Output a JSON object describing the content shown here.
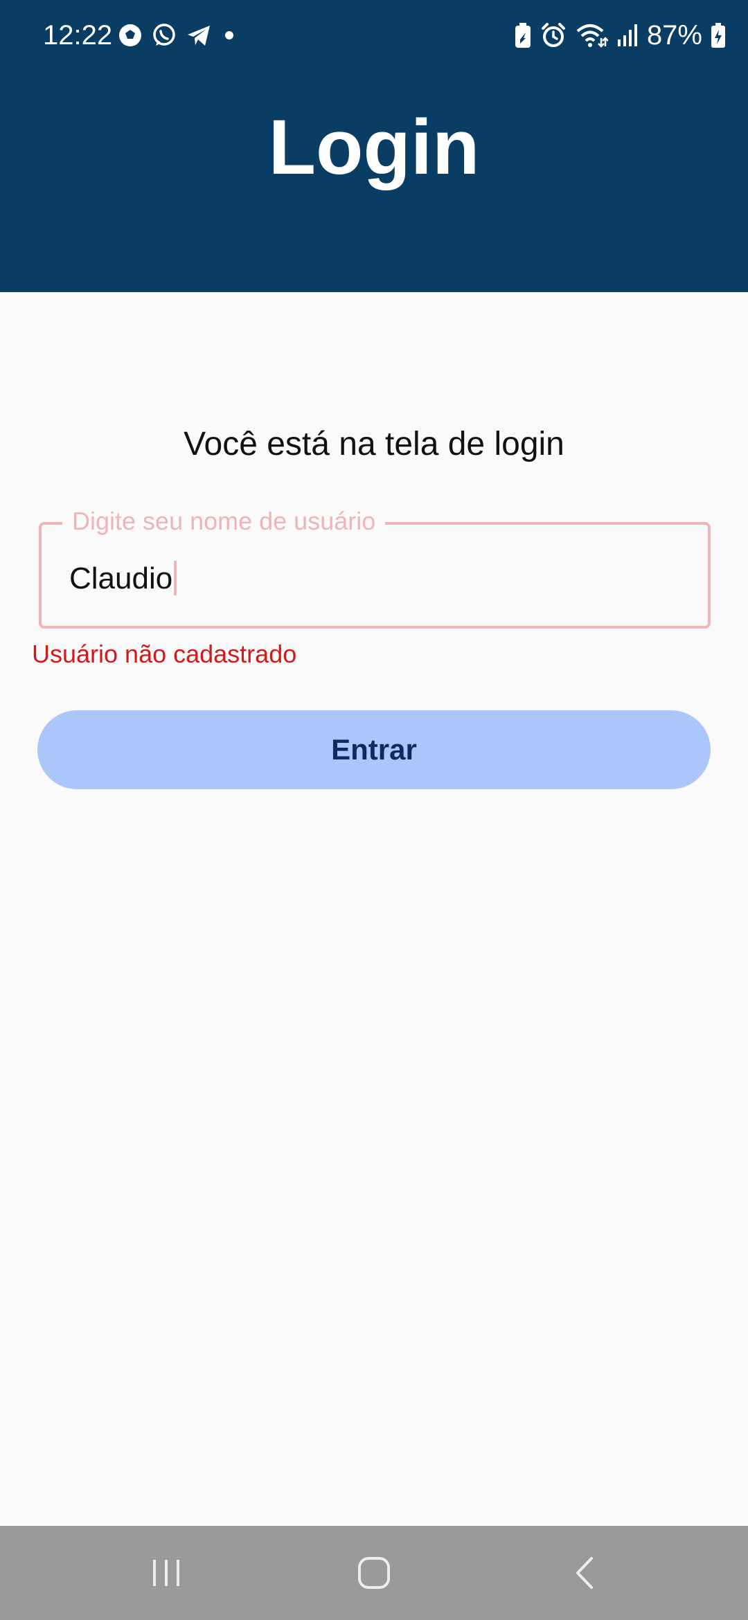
{
  "status_bar": {
    "time": "12:22",
    "battery_percent": "87%",
    "left_icons": [
      "soccer-ball-icon",
      "whatsapp-icon",
      "telegram-icon",
      "dot-icon"
    ],
    "right_icons": [
      "battery-saver-icon",
      "alarm-icon",
      "wifi-icon",
      "signal-icon",
      "battery-charging-icon"
    ]
  },
  "header": {
    "title": "Login",
    "background_color": "#0a3d63"
  },
  "main": {
    "subtitle": "Você está na tela de login",
    "username_field": {
      "label": "Digite seu nome de usuário",
      "value": "Claudio"
    },
    "error_message": "Usuário não cadastrado",
    "enter_button_label": "Entrar"
  },
  "colors": {
    "error": "#d11a1a",
    "field_border_error": "#efb4b6",
    "button_background": "#adc6fa",
    "button_text": "#0f2a5c"
  },
  "nav_bar": {
    "buttons": [
      "recent-apps-icon",
      "home-icon",
      "back-icon"
    ]
  }
}
